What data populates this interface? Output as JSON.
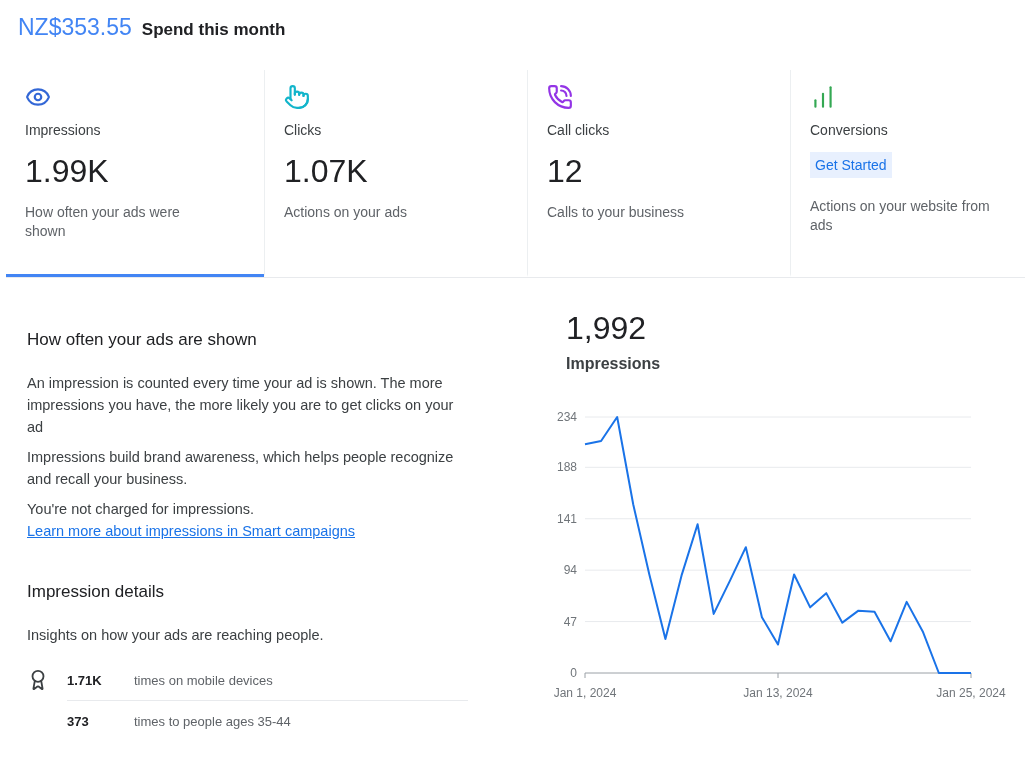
{
  "spend": {
    "amount": "NZ$353.55",
    "label": "Spend this month"
  },
  "tabs": [
    {
      "label": "Impressions",
      "kind": "value",
      "value": "1.99K",
      "description": "How often your ads were shown",
      "color": "#3367d6",
      "selected": true
    },
    {
      "label": "Clicks",
      "kind": "value",
      "value": "1.07K",
      "description": "Actions on your ads",
      "color": "#12b5cb",
      "selected": false
    },
    {
      "label": "Call clicks",
      "kind": "value",
      "value": "12",
      "description": "Calls to your business",
      "color": "#9334e6",
      "selected": false
    },
    {
      "label": "Conversions",
      "kind": "action",
      "value": "Get Started",
      "description": "Actions on your website from ads",
      "color": "#34a853",
      "selected": false
    }
  ],
  "info": {
    "heading": "How often your ads are shown",
    "paragraphs": [
      {
        "text": "An impression is counted every time your ad is shown. The more impressions you have, the more likely you are to get clicks on your ad"
      },
      {
        "text": "Impressions build brand awareness, which helps people recognize and recall your business."
      },
      {
        "text": "You're not charged for impressions.",
        "link": "Learn more about impressions in Smart campaigns"
      }
    ]
  },
  "details": {
    "heading": "Impression details",
    "subtitle": "Insights on how your ads are reaching people.",
    "rows": [
      {
        "value": "1.71K",
        "label": "times on mobile devices"
      },
      {
        "value": "373",
        "label": "times to people ages 35-44"
      }
    ]
  },
  "summary": {
    "value": "1,992"
  },
  "chart": {
    "chart_data": {
      "type": "line",
      "categories": [
        "Jan 1, 2024",
        null,
        null,
        null,
        null,
        null,
        null,
        null,
        null,
        null,
        null,
        null,
        "Jan 13, 2024",
        null,
        null,
        null,
        null,
        null,
        null,
        null,
        null,
        null,
        null,
        null,
        "Jan 25, 2024"
      ],
      "series": [
        {
          "name": "Impressions",
          "color": "#1a73e8",
          "values": [
            209,
            212,
            234,
            154,
            90,
            31,
            89,
            136,
            54,
            84,
            115,
            51,
            26,
            90,
            60,
            73,
            46,
            57,
            56,
            29,
            65,
            38,
            0,
            0,
            0
          ]
        }
      ],
      "ylim": [
        0,
        234
      ],
      "grid": true,
      "yticks": [
        0,
        47,
        94,
        141,
        188,
        234
      ]
    }
  }
}
